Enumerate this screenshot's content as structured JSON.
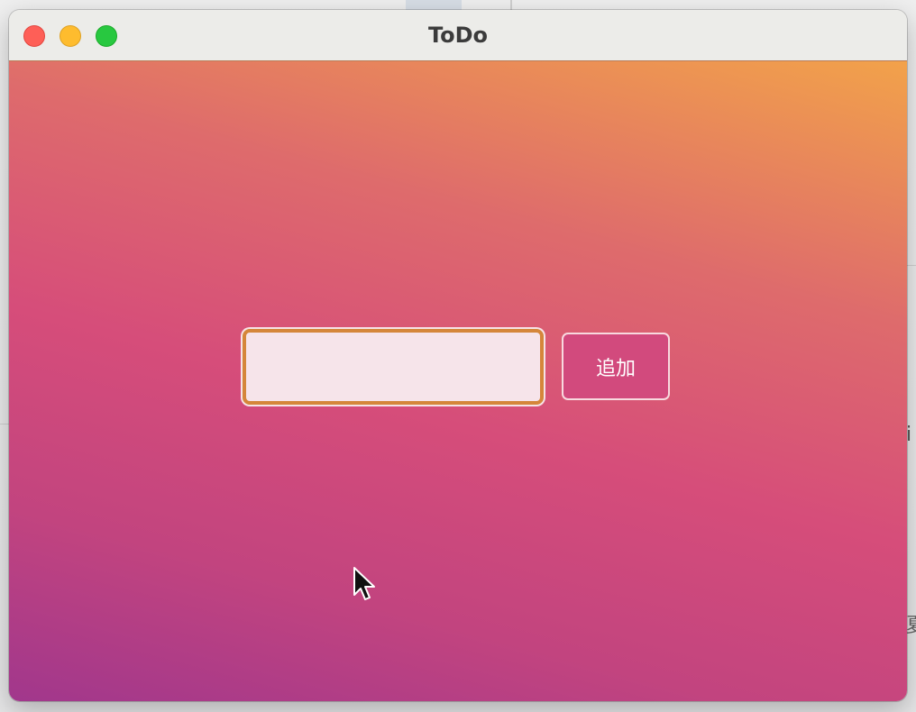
{
  "window": {
    "title": "ToDo",
    "controls": [
      "close",
      "minimize",
      "zoom"
    ]
  },
  "todo_form": {
    "input_value": "",
    "input_placeholder": "",
    "add_button_label": "追加"
  },
  "colors": {
    "close": "#fe5f57",
    "minimize": "#febc2e",
    "zoom": "#28c840",
    "gradient_start": "#a1378c",
    "gradient_mid": "#d64d7a",
    "gradient_end": "#f2a24a",
    "input_focus_border": "#d5863a",
    "button_background": "#d24a7d"
  },
  "icons": {
    "cursor": "mouse-pointer-icon"
  }
}
